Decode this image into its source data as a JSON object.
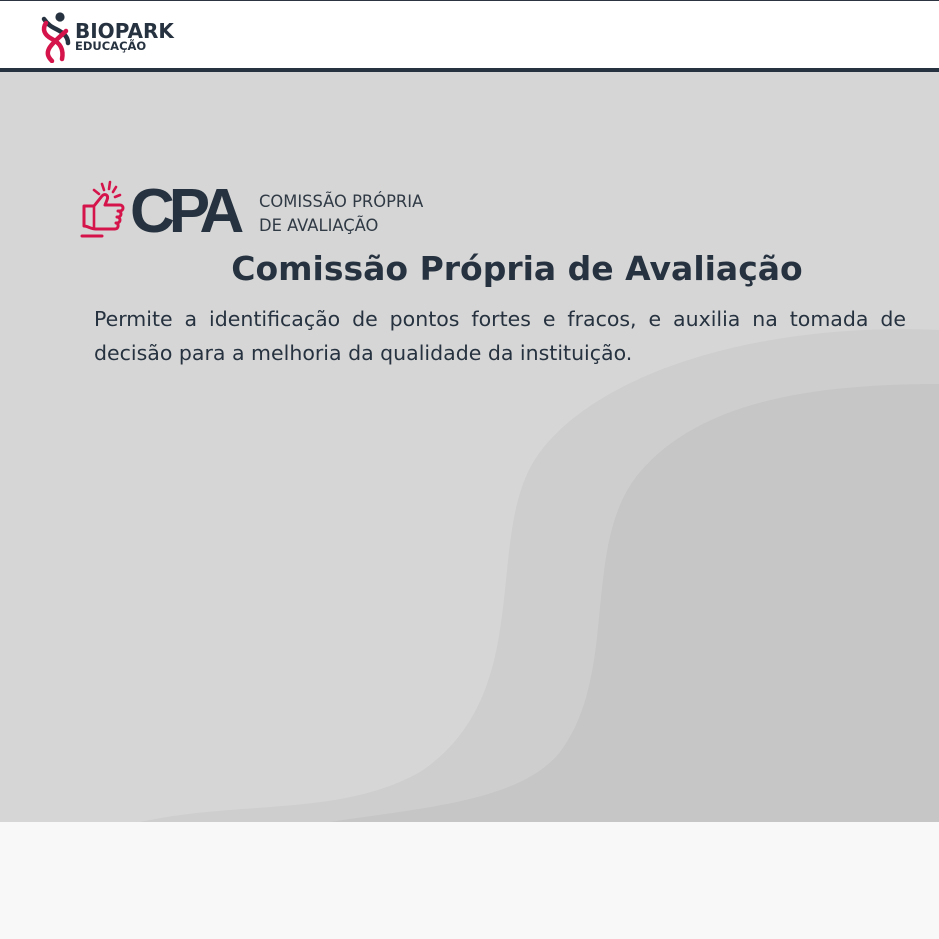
{
  "header": {
    "logo": {
      "name": "BIOPARK",
      "subtitle": "EDUCAÇÃO"
    }
  },
  "hero": {
    "cpa_logo": {
      "letters": "CPA",
      "line1": "COMISSÃO PRÓPRIA",
      "line2": "DE AVALIAÇÃO"
    },
    "title": "Comissão Própria de Avaliação",
    "description": "Permite a identificação de pontos fortes e fracos, e auxilia na tomada de decisão para a melhoria da qualidade da instituição."
  },
  "colors": {
    "brand_dark": "#26323f",
    "brand_accent": "#d4144a",
    "hero_background": "#d6d6d6",
    "page_background": "#f8f8f8"
  },
  "icons": {
    "biopark_logo": "dna-figure-logo-icon",
    "cpa_logo": "thumbs-up-idea-icon"
  }
}
